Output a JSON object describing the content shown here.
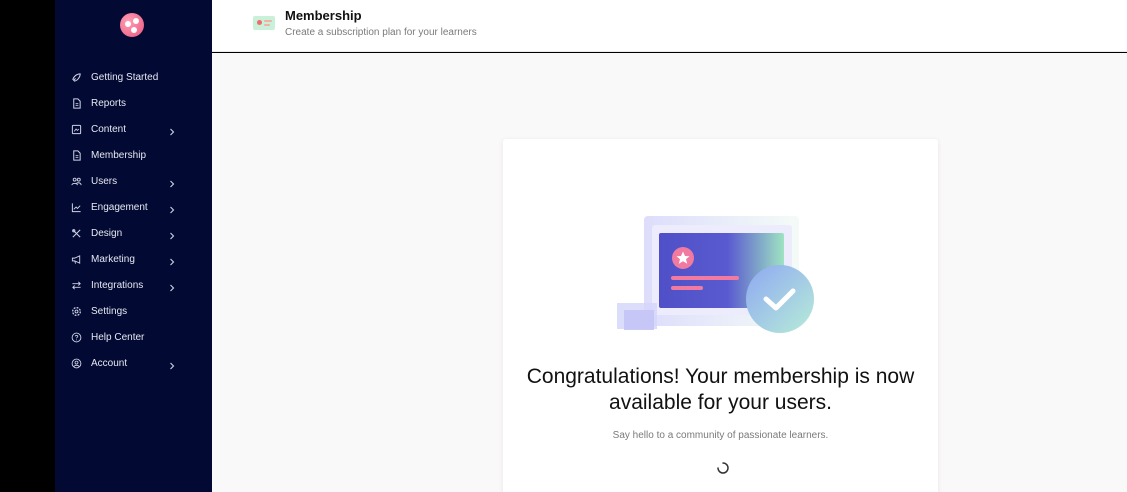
{
  "sidebar": {
    "items": [
      {
        "label": "Getting Started",
        "icon": "rocket-icon",
        "has_submenu": false
      },
      {
        "label": "Reports",
        "icon": "document-icon",
        "has_submenu": false
      },
      {
        "label": "Content",
        "icon": "content-icon",
        "has_submenu": true
      },
      {
        "label": "Membership",
        "icon": "document-icon",
        "has_submenu": false
      },
      {
        "label": "Users",
        "icon": "users-icon",
        "has_submenu": true
      },
      {
        "label": "Engagement",
        "icon": "chart-icon",
        "has_submenu": true
      },
      {
        "label": "Design",
        "icon": "design-icon",
        "has_submenu": true
      },
      {
        "label": "Marketing",
        "icon": "megaphone-icon",
        "has_submenu": true
      },
      {
        "label": "Integrations",
        "icon": "arrows-icon",
        "has_submenu": true
      },
      {
        "label": "Settings",
        "icon": "gear-icon",
        "has_submenu": false
      },
      {
        "label": "Help Center",
        "icon": "help-icon",
        "has_submenu": false
      },
      {
        "label": "Account",
        "icon": "user-circle-icon",
        "has_submenu": true
      }
    ]
  },
  "header": {
    "title": "Membership",
    "subtitle": "Create a subscription plan for your learners"
  },
  "card": {
    "headline": "Congratulations! Your membership is now available for your users.",
    "subtext": "Say hello to a community of passionate learners."
  },
  "colors": {
    "sidebar_bg": "#020a33",
    "accent": "#e9577f",
    "illustration_purple": "#4f4fc7"
  }
}
